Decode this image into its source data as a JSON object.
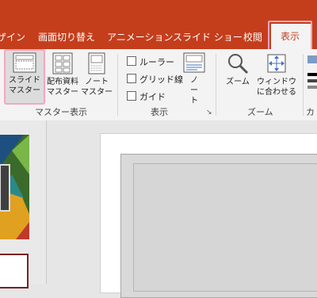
{
  "tabs": [
    {
      "id": "design",
      "label": "デザイン"
    },
    {
      "id": "transitions",
      "label": "画面切り替え"
    },
    {
      "id": "animations",
      "label": "アニメーション"
    },
    {
      "id": "slideshow",
      "label": "スライド ショー"
    },
    {
      "id": "review",
      "label": "校閲"
    },
    {
      "id": "view",
      "label": "表示"
    }
  ],
  "groups": {
    "master_view": {
      "label": "マスター表示",
      "buttons": [
        {
          "line1": "スライド",
          "line2": "マスター"
        },
        {
          "line1": "配布資料",
          "line2": "マスター"
        },
        {
          "line1": "ノート",
          "line2": "マスター"
        }
      ]
    },
    "show": {
      "label": "表示",
      "checkboxes": [
        {
          "label": "ルーラー",
          "checked": false
        },
        {
          "label": "グリッド線",
          "checked": false
        },
        {
          "label": "ガイド",
          "checked": false
        }
      ],
      "notes_button": {
        "line1": "ノ",
        "line2": "ー",
        "line3": "ト"
      }
    },
    "zoom": {
      "label": "ズーム",
      "buttons": [
        {
          "line1": "ズーム",
          "line2": ""
        },
        {
          "line1": "ウィンドウ",
          "line2": "に合わせる"
        }
      ]
    },
    "color": {
      "label": "カラ"
    }
  },
  "colors": {
    "accent": "#c43e1c",
    "highlight": "#f2a6c0",
    "selected_slide_border": "#7a2020"
  }
}
